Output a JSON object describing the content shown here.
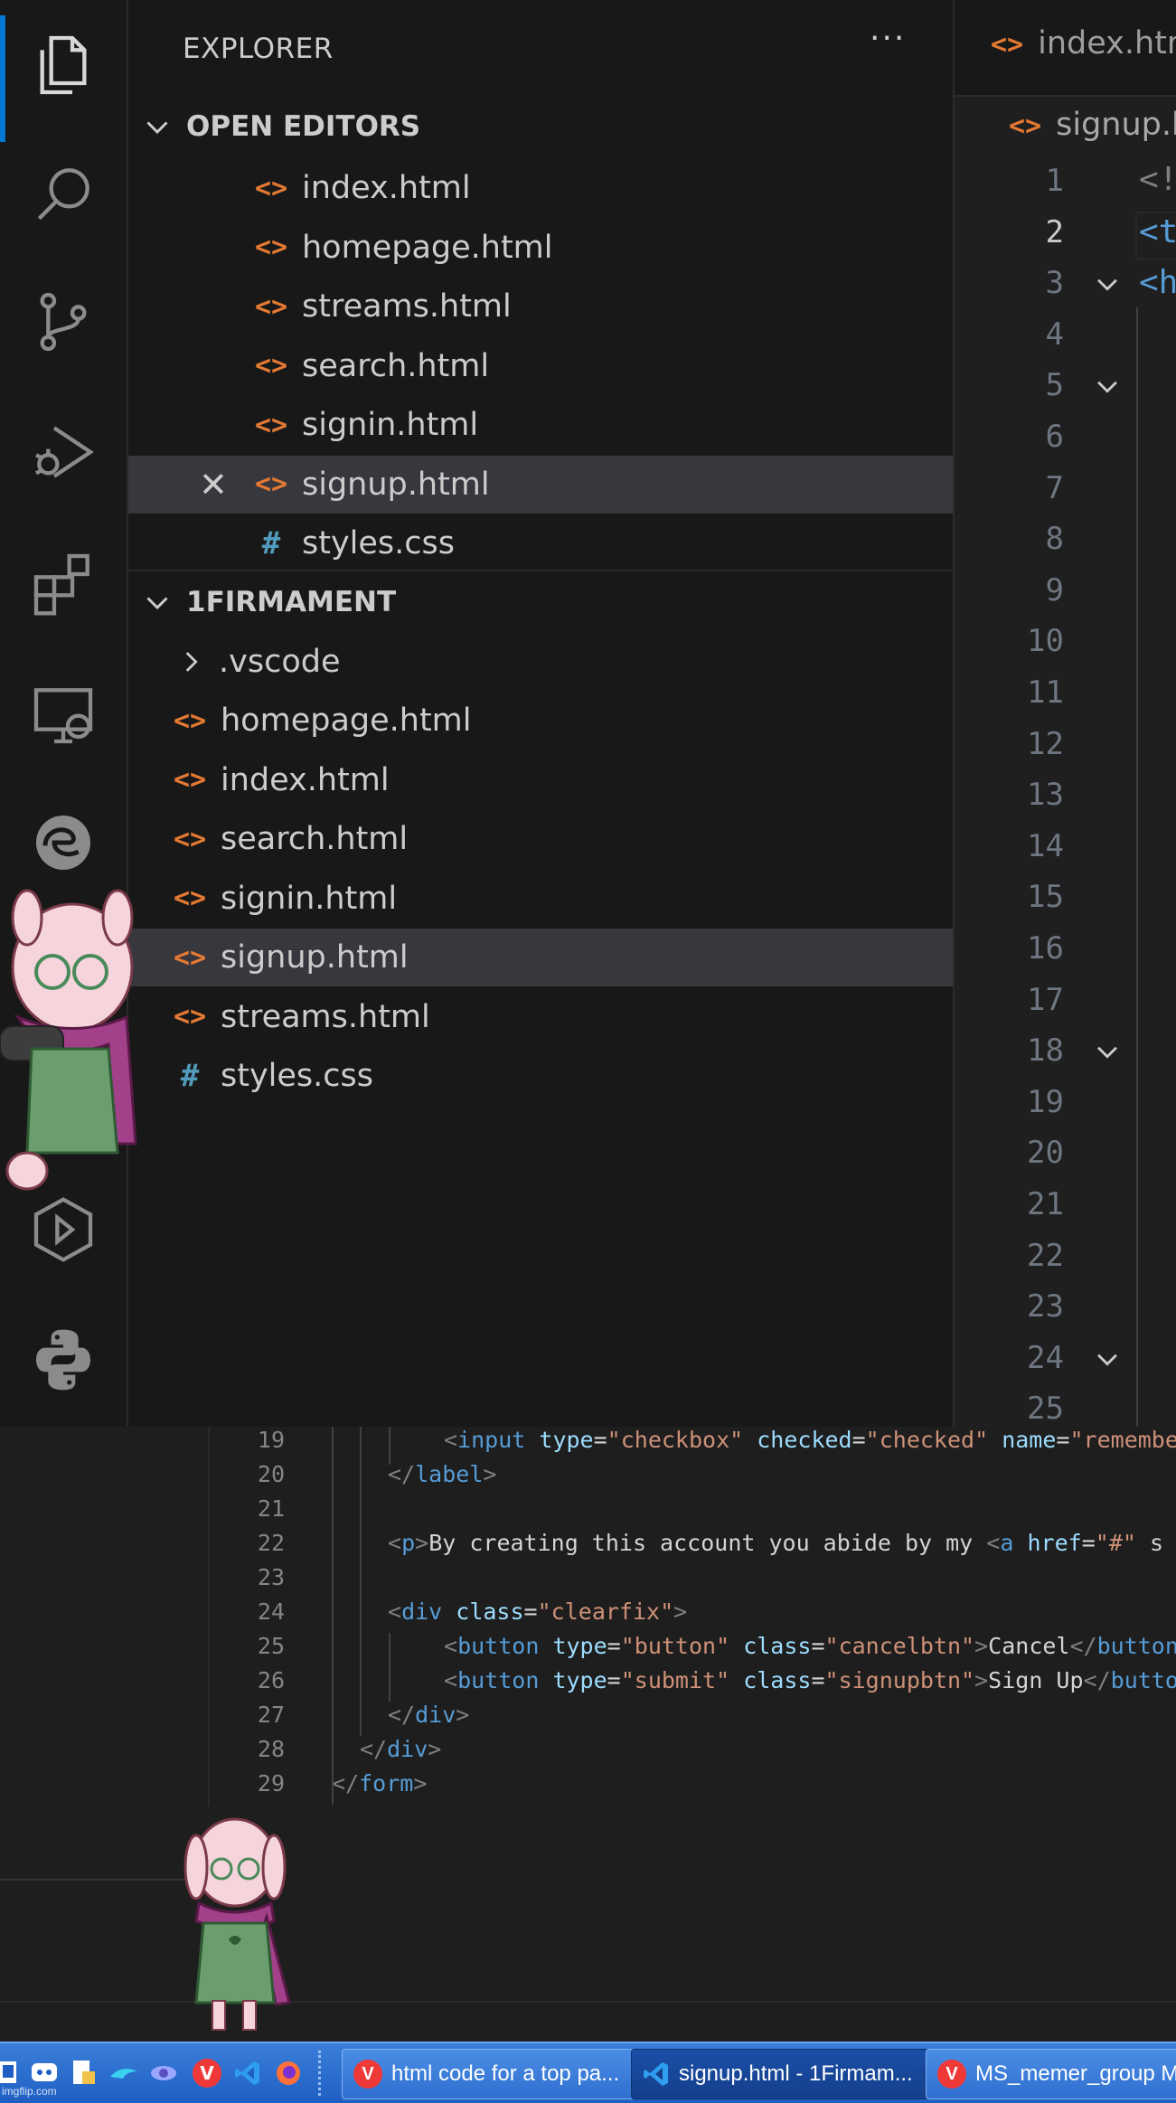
{
  "sidebar": {
    "title": "EXPLORER",
    "more_label": "···",
    "open_editors": {
      "title": "OPEN EDITORS",
      "items": [
        {
          "label": "index.html",
          "type": "html"
        },
        {
          "label": "homepage.html",
          "type": "html"
        },
        {
          "label": "streams.html",
          "type": "html"
        },
        {
          "label": "search.html",
          "type": "html"
        },
        {
          "label": "signin.html",
          "type": "html"
        },
        {
          "label": "signup.html",
          "type": "html",
          "selected": true,
          "close": "✕"
        },
        {
          "label": "styles.css",
          "type": "css"
        }
      ]
    },
    "workspace": {
      "title": "1FIRMAMENT",
      "folder": ".vscode",
      "items": [
        {
          "label": "homepage.html",
          "type": "html"
        },
        {
          "label": "index.html",
          "type": "html"
        },
        {
          "label": "search.html",
          "type": "html"
        },
        {
          "label": "signin.html",
          "type": "html"
        },
        {
          "label": "signup.html",
          "type": "html",
          "selected": true
        },
        {
          "label": "streams.html",
          "type": "html"
        },
        {
          "label": "styles.css",
          "type": "css"
        }
      ]
    }
  },
  "icons": {
    "html": "<>",
    "css": "#"
  },
  "editor": {
    "tab_label": "index.htm",
    "breadcrumb": "signup.h",
    "line_numbers": [
      "1",
      "2",
      "3",
      "4",
      "5",
      "6",
      "7",
      "8",
      "9",
      "10",
      "11",
      "12",
      "13",
      "14",
      "15",
      "16",
      "17",
      "18",
      "19",
      "20",
      "21",
      "22",
      "23",
      "24",
      "25"
    ],
    "fragments": [
      "<!",
      "<t",
      "<h"
    ]
  },
  "lower_code": {
    "lines": [
      {
        "num": "19",
        "parts": [
          [
            "tg",
            "<"
          ],
          [
            "tn",
            "input"
          ],
          [
            "pl",
            " "
          ],
          [
            "at",
            "type"
          ],
          [
            "pl",
            "="
          ],
          [
            "st",
            "\"checkbox\""
          ],
          [
            "pl",
            " "
          ],
          [
            "at",
            "checked"
          ],
          [
            "pl",
            "="
          ],
          [
            "st",
            "\"checked\""
          ],
          [
            "pl",
            " "
          ],
          [
            "at",
            "name"
          ],
          [
            "pl",
            "="
          ],
          [
            "st",
            "\"remember"
          ]
        ],
        "indent": 2
      },
      {
        "num": "20",
        "parts": [
          [
            "tg",
            "</"
          ],
          [
            "tn",
            "label"
          ],
          [
            "tg",
            ">"
          ]
        ],
        "indent": 1
      },
      {
        "num": "21",
        "parts": [],
        "indent": 1
      },
      {
        "num": "22",
        "parts": [
          [
            "tg",
            "<"
          ],
          [
            "tn",
            "p"
          ],
          [
            "tg",
            ">"
          ],
          [
            "pl",
            "By creating this account you abide by my "
          ],
          [
            "tg",
            "<"
          ],
          [
            "tn",
            "a"
          ],
          [
            "pl",
            " "
          ],
          [
            "at",
            "href"
          ],
          [
            "pl",
            "="
          ],
          [
            "st",
            "\"#\""
          ],
          [
            "pl",
            " s"
          ]
        ],
        "indent": 1
      },
      {
        "num": "23",
        "parts": [],
        "indent": 1
      },
      {
        "num": "24",
        "parts": [
          [
            "tg",
            "<"
          ],
          [
            "tn",
            "div"
          ],
          [
            "pl",
            " "
          ],
          [
            "at",
            "class"
          ],
          [
            "pl",
            "="
          ],
          [
            "st",
            "\"clearfix\""
          ],
          [
            "tg",
            ">"
          ]
        ],
        "indent": 1
      },
      {
        "num": "25",
        "parts": [
          [
            "tg",
            "<"
          ],
          [
            "tn",
            "button"
          ],
          [
            "pl",
            " "
          ],
          [
            "at",
            "type"
          ],
          [
            "pl",
            "="
          ],
          [
            "st",
            "\"button\""
          ],
          [
            "pl",
            " "
          ],
          [
            "at",
            "class"
          ],
          [
            "pl",
            "="
          ],
          [
            "st",
            "\"cancelbtn\""
          ],
          [
            "tg",
            ">"
          ],
          [
            "pl",
            "Cancel"
          ],
          [
            "tg",
            "</"
          ],
          [
            "tn",
            "button"
          ],
          [
            "tg",
            ">"
          ]
        ],
        "indent": 2
      },
      {
        "num": "26",
        "parts": [
          [
            "tg",
            "<"
          ],
          [
            "tn",
            "button"
          ],
          [
            "pl",
            " "
          ],
          [
            "at",
            "type"
          ],
          [
            "pl",
            "="
          ],
          [
            "st",
            "\"submit\""
          ],
          [
            "pl",
            " "
          ],
          [
            "at",
            "class"
          ],
          [
            "pl",
            "="
          ],
          [
            "st",
            "\"signupbtn\""
          ],
          [
            "tg",
            ">"
          ],
          [
            "pl",
            "Sign Up"
          ],
          [
            "tg",
            "</"
          ],
          [
            "tn",
            "butto"
          ]
        ],
        "indent": 2
      },
      {
        "num": "27",
        "parts": [
          [
            "tg",
            "</"
          ],
          [
            "tn",
            "div"
          ],
          [
            "tg",
            ">"
          ]
        ],
        "indent": 1
      },
      {
        "num": "28",
        "parts": [
          [
            "tg",
            "</"
          ],
          [
            "tn",
            "div"
          ],
          [
            "tg",
            ">"
          ]
        ],
        "indent": 0.5
      },
      {
        "num": "29",
        "parts": [
          [
            "tg",
            "</"
          ],
          [
            "tn",
            "form"
          ],
          [
            "tg",
            ">"
          ]
        ],
        "indent": 0
      }
    ]
  },
  "taskbar": {
    "tasks": [
      {
        "label": "html code for a top pa...",
        "app": "vivaldi",
        "active": false
      },
      {
        "label": "signup.html - 1Firmam...",
        "app": "vscode",
        "active": true
      },
      {
        "label": "MS_memer_group Me...",
        "app": "vivaldi",
        "active": false
      }
    ],
    "watermark": "imgflip.com"
  },
  "colors": {
    "accent": "#0078d4",
    "html_icon": "#e37933",
    "css_icon": "#519aba",
    "taskbar": "#2f6fd0"
  }
}
